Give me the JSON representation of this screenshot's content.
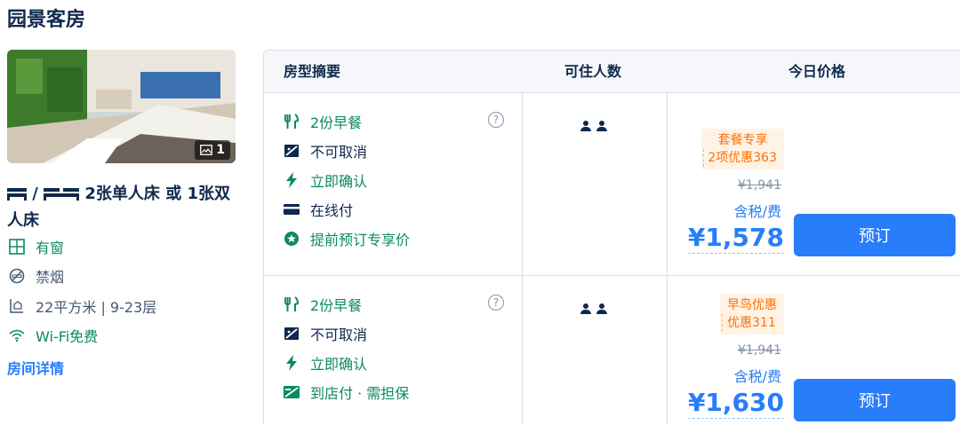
{
  "page": {
    "title": "园景客房"
  },
  "room": {
    "photo_count": "1",
    "beds_text": "/ ",
    "beds_text2": "2张单人床 或 1张双人床",
    "facilities": [
      {
        "icon": "window-icon",
        "label": "有窗"
      },
      {
        "icon": "no-smoking-icon",
        "label": "禁烟"
      },
      {
        "icon": "area-icon",
        "label": "22平方米 | 9-23层"
      },
      {
        "icon": "wifi-icon",
        "label": "Wi-Fi免费"
      }
    ],
    "details_link": "房间详情"
  },
  "table": {
    "headers": {
      "summary": "房型摘要",
      "occupancy": "可住人数",
      "price": "今日价格"
    },
    "rows": [
      {
        "features": [
          {
            "icon": "breakfast-icon",
            "label": "2份早餐"
          },
          {
            "icon": "no-cancel-icon",
            "label": "不可取消"
          },
          {
            "icon": "lightning-icon",
            "label": "立即确认"
          },
          {
            "icon": "card-icon",
            "label": "在线付"
          },
          {
            "icon": "star-badge-icon",
            "label": "提前预订专享价"
          }
        ],
        "promo_title": "套餐专享",
        "promo_sub": "2项优惠363",
        "original_price": "¥1,941",
        "tax_note": "含税/费",
        "price": "¥1,578",
        "book_label": "预订"
      },
      {
        "features": [
          {
            "icon": "breakfast-icon",
            "label": "2份早餐"
          },
          {
            "icon": "no-cancel-icon",
            "label": "不可取消"
          },
          {
            "icon": "lightning-icon",
            "label": "立即确认"
          },
          {
            "icon": "pay-at-hotel-icon",
            "label": "到店付 · 需担保"
          }
        ],
        "promo_title": "早鸟优惠",
        "promo_sub": "优惠311",
        "original_price": "¥1,941",
        "tax_note": "含税/费",
        "price": "¥1,630",
        "book_label": "预订"
      }
    ],
    "help_glyph": "?"
  },
  "colors": {
    "accent": "#287dfa",
    "green": "#0a8a5f",
    "promo": "#ff6f00",
    "text": "#0f294d"
  }
}
